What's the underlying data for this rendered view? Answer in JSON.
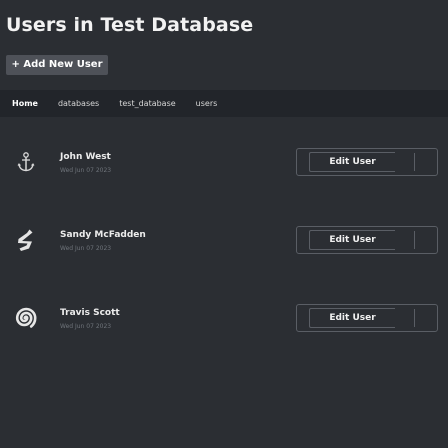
{
  "header": {
    "title": "Users in Test Database",
    "add_button_label": "+ Add New User"
  },
  "breadcrumb": {
    "items": [
      "Home",
      "databases",
      "test_database",
      "users"
    ]
  },
  "users": [
    {
      "name": "John West",
      "date": "Wed Jun 07 2023",
      "avatar_icon": "anchor-icon",
      "edit_label": "Edit User"
    },
    {
      "name": "Sandy McFadden",
      "date": "Wed Jun 07 2023",
      "avatar_icon": "rune-icon",
      "edit_label": "Edit User"
    },
    {
      "name": "Travis Scott",
      "date": "Wed Jun 07 2023",
      "avatar_icon": "spiral-icon",
      "edit_label": "Edit User"
    }
  ],
  "colors": {
    "background": "#2b2e33",
    "breadcrumb_bar": "#22252a",
    "button_bg": "#4e5158",
    "border": "#5a5e65",
    "muted_text": "#6e737a"
  }
}
